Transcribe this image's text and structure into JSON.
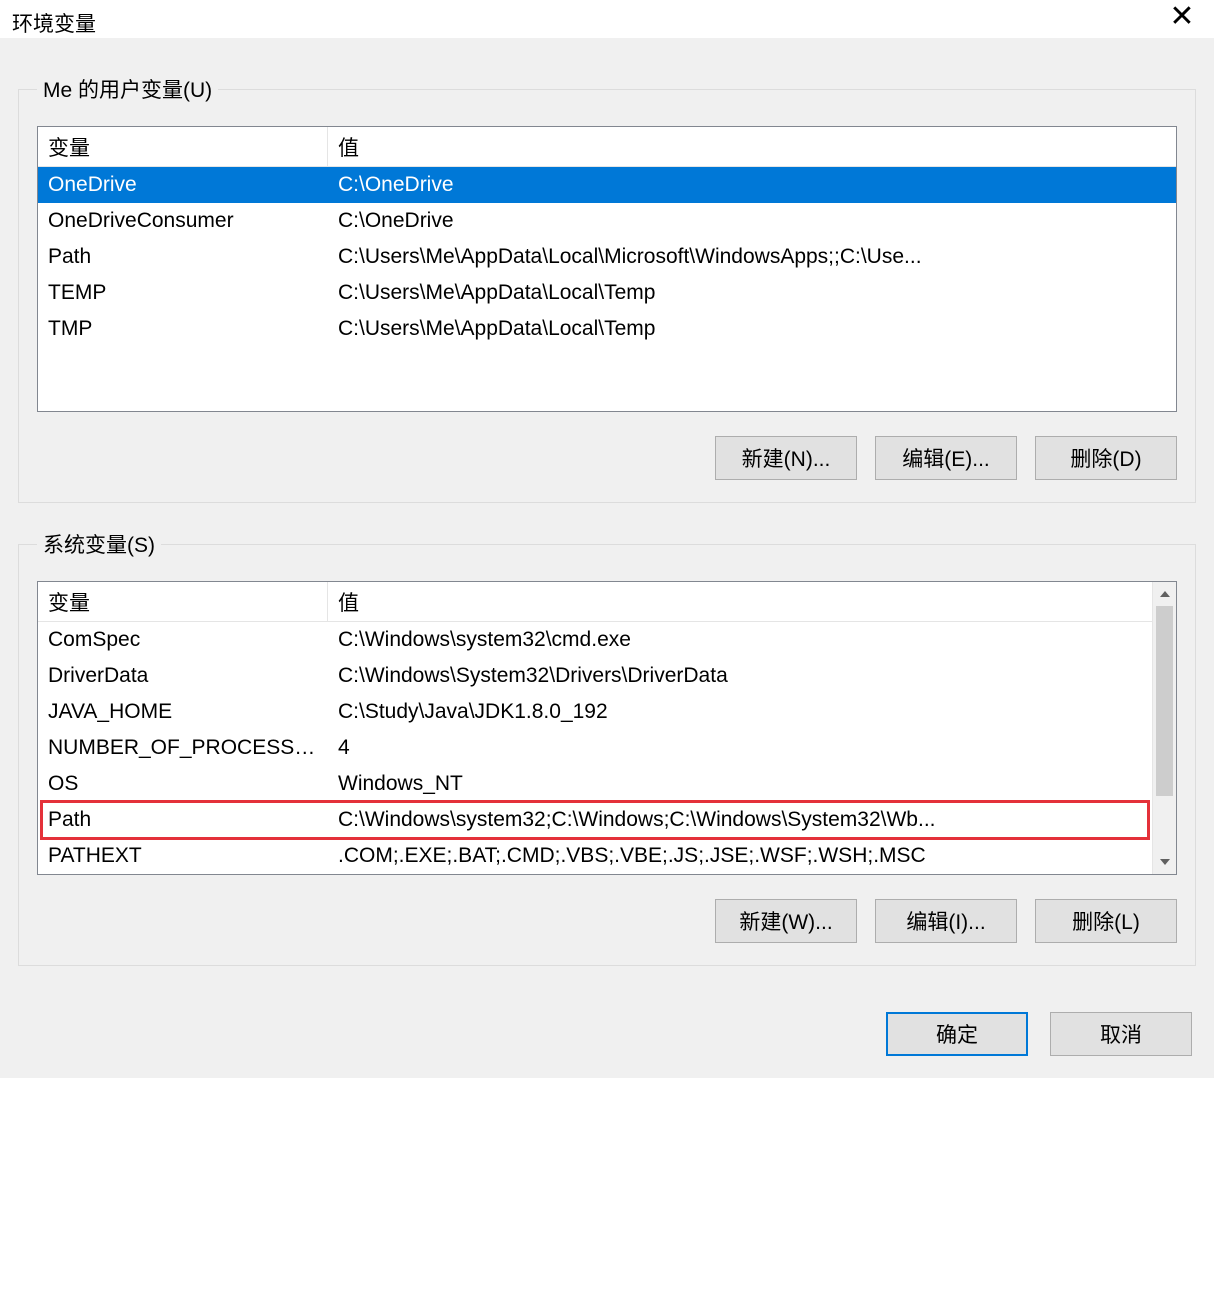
{
  "window": {
    "title": "环境变量"
  },
  "user_group": {
    "legend": "Me 的用户变量(U)",
    "col_var": "变量",
    "col_val": "值",
    "rows": [
      {
        "name": "OneDrive",
        "value": "C:\\OneDrive",
        "selected": true
      },
      {
        "name": "OneDriveConsumer",
        "value": "C:\\OneDrive"
      },
      {
        "name": "Path",
        "value": "C:\\Users\\Me\\AppData\\Local\\Microsoft\\WindowsApps;;C:\\Use..."
      },
      {
        "name": "TEMP",
        "value": "C:\\Users\\Me\\AppData\\Local\\Temp"
      },
      {
        "name": "TMP",
        "value": "C:\\Users\\Me\\AppData\\Local\\Temp"
      }
    ],
    "buttons": {
      "new": "新建(N)...",
      "edit": "编辑(E)...",
      "delete": "删除(D)"
    }
  },
  "system_group": {
    "legend": "系统变量(S)",
    "col_var": "变量",
    "col_val": "值",
    "rows": [
      {
        "name": "ComSpec",
        "value": "C:\\Windows\\system32\\cmd.exe"
      },
      {
        "name": "DriverData",
        "value": "C:\\Windows\\System32\\Drivers\\DriverData"
      },
      {
        "name": "JAVA_HOME",
        "value": "C:\\Study\\Java\\JDK1.8.0_192"
      },
      {
        "name": "NUMBER_OF_PROCESSORS",
        "value": "4"
      },
      {
        "name": "OS",
        "value": "Windows_NT"
      },
      {
        "name": "Path",
        "value": "C:\\Windows\\system32;C:\\Windows;C:\\Windows\\System32\\Wb...",
        "highlight": true
      },
      {
        "name": "PATHEXT",
        "value": ".COM;.EXE;.BAT;.CMD;.VBS;.VBE;.JS;.JSE;.WSF;.WSH;.MSC"
      }
    ],
    "buttons": {
      "new": "新建(W)...",
      "edit": "编辑(I)...",
      "delete": "删除(L)"
    }
  },
  "footer": {
    "ok": "确定",
    "cancel": "取消"
  }
}
